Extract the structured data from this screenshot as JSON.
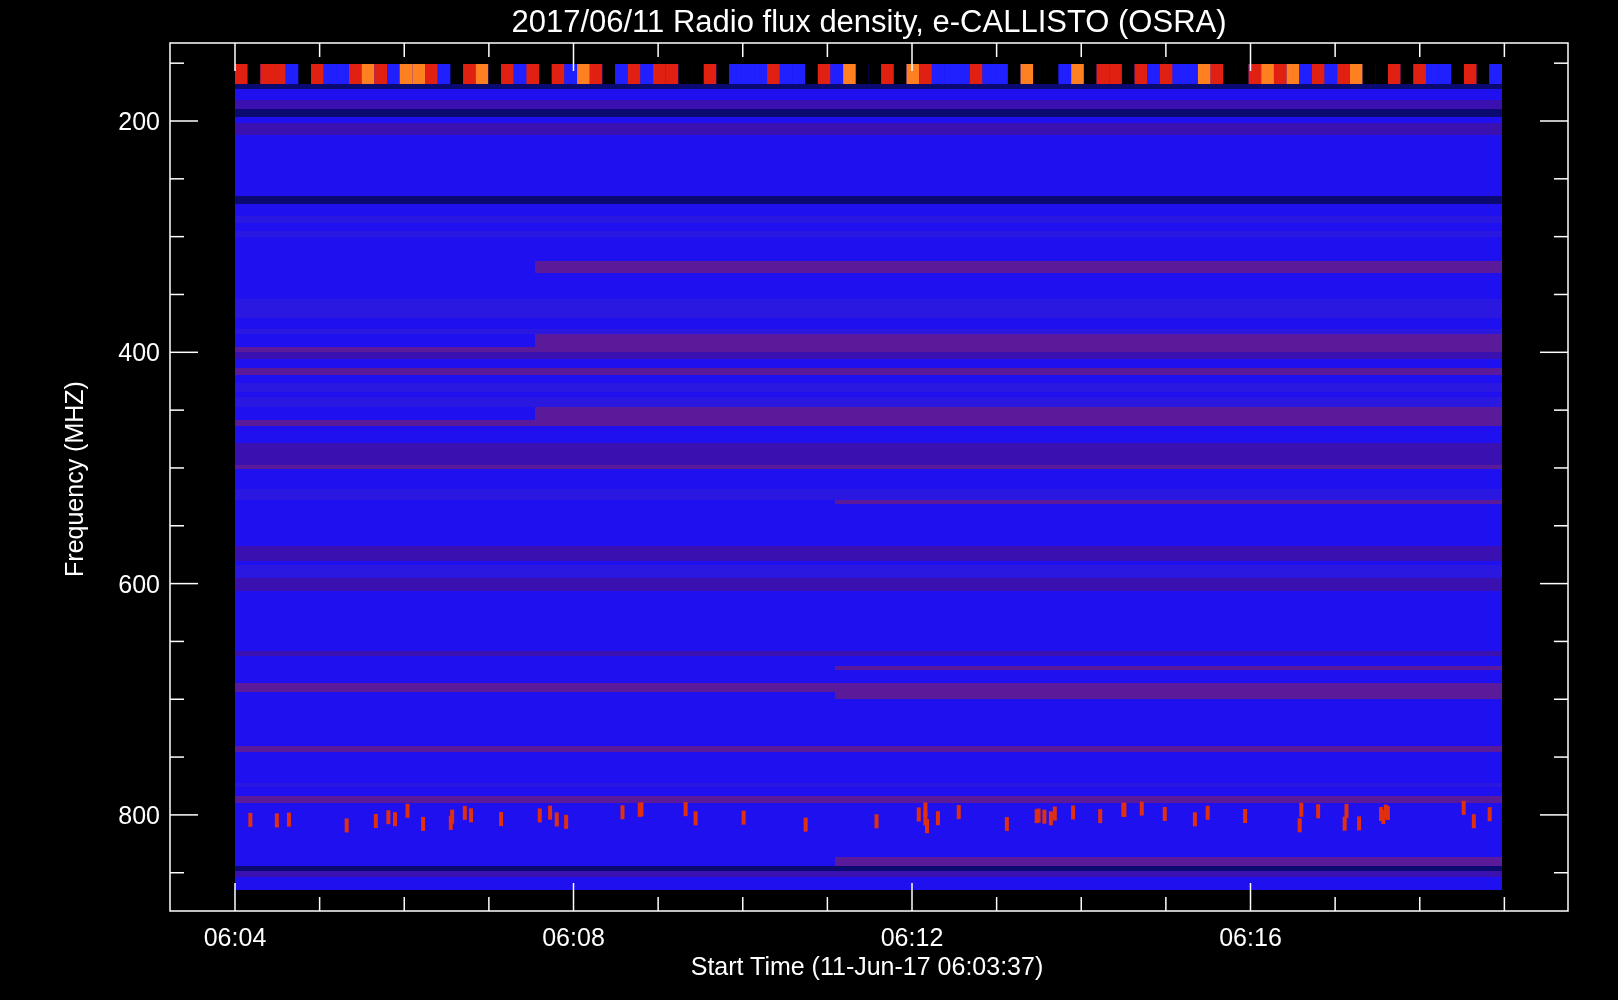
{
  "title": "2017/06/11  Radio flux density, e-CALLISTO (OSRA)",
  "y_axis": {
    "label": "Frequency (MHZ)",
    "ticks": [
      "200",
      "400",
      "600",
      "800"
    ]
  },
  "x_axis": {
    "label": "Start Time (11-Jun-17 06:03:37)",
    "ticks": [
      "06:04",
      "06:08",
      "06:12",
      "06:16"
    ]
  }
}
